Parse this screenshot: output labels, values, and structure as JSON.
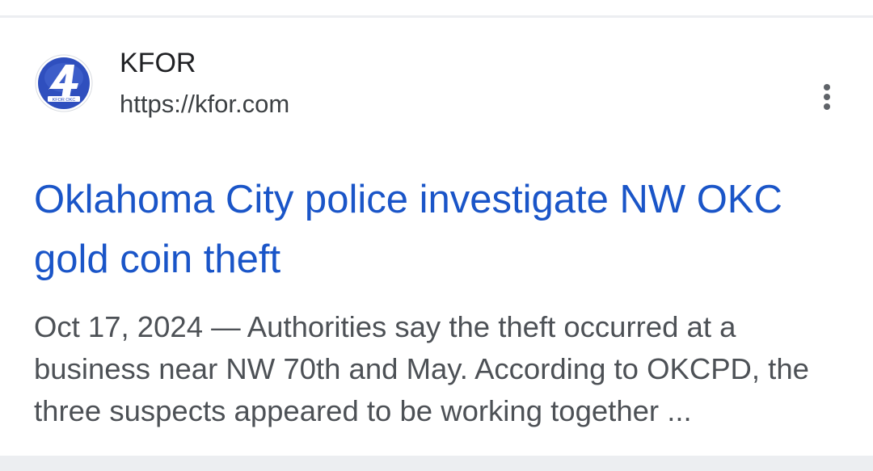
{
  "result": {
    "site_name": "KFOR",
    "site_url": "https://kfor.com",
    "favicon_label": "4",
    "favicon_caption": "KFOR OKC",
    "title": "Oklahoma City police investigate NW OKC gold coin theft",
    "date": "Oct 17, 2024",
    "separator": " — ",
    "snippet": "Authorities say the theft occurred at a business near NW 70th and May. According to OKCPD, the three suspects appeared to be working together ...",
    "more_icon": "more-vert-icon"
  },
  "colors": {
    "title_link": "#1a55c8",
    "site_name": "#202124",
    "snippet": "#4d5156",
    "logo_blue": "#2f4fbe",
    "divider": "#eceef1"
  }
}
